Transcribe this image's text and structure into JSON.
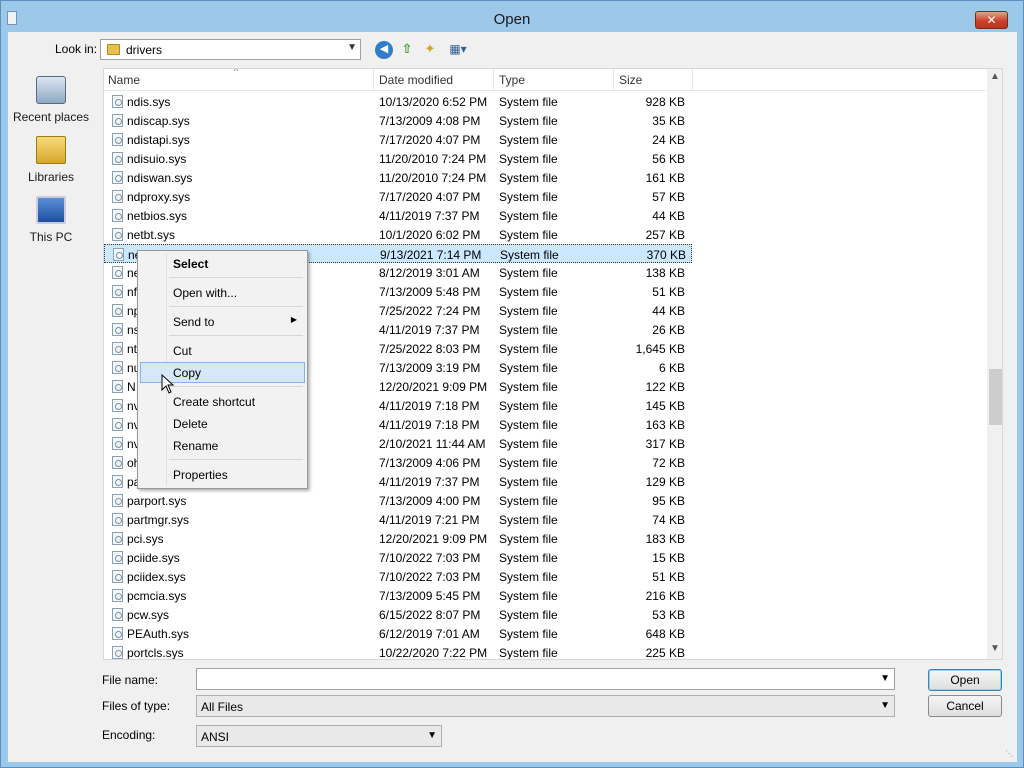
{
  "window": {
    "title": "Open",
    "close_label": "✕"
  },
  "toolbar": {
    "lookin_label": "Look in:",
    "lookin_value": "drivers",
    "back_icon": "back-icon",
    "up_icon": "up-folder-icon",
    "new_folder_icon": "new-folder-icon",
    "view_icon": "view-menu-icon"
  },
  "places": [
    {
      "label": "Recent places",
      "icon": "recent-places-icon"
    },
    {
      "label": "Libraries",
      "icon": "libraries-icon"
    },
    {
      "label": "This PC",
      "icon": "this-pc-icon"
    }
  ],
  "columns": {
    "name": "Name",
    "date": "Date modified",
    "type": "Type",
    "size": "Size"
  },
  "files": [
    {
      "name": "ndis.sys",
      "date": "10/13/2020 6:52 PM",
      "type": "System file",
      "size": "928 KB"
    },
    {
      "name": "ndiscap.sys",
      "date": "7/13/2009 4:08 PM",
      "type": "System file",
      "size": "35 KB"
    },
    {
      "name": "ndistapi.sys",
      "date": "7/17/2020 4:07 PM",
      "type": "System file",
      "size": "24 KB"
    },
    {
      "name": "ndisuio.sys",
      "date": "11/20/2010 7:24 PM",
      "type": "System file",
      "size": "56 KB"
    },
    {
      "name": "ndiswan.sys",
      "date": "11/20/2010 7:24 PM",
      "type": "System file",
      "size": "161 KB"
    },
    {
      "name": "ndproxy.sys",
      "date": "7/17/2020 4:07 PM",
      "type": "System file",
      "size": "57 KB"
    },
    {
      "name": "netbios.sys",
      "date": "4/11/2019 7:37 PM",
      "type": "System file",
      "size": "44 KB"
    },
    {
      "name": "netbt.sys",
      "date": "10/1/2020 6:02 PM",
      "type": "System file",
      "size": "257 KB"
    },
    {
      "name": "ne",
      "date": "9/13/2021 7:14 PM",
      "type": "System file",
      "size": "370 KB"
    },
    {
      "name": "ne",
      "date": "8/12/2019 3:01 AM",
      "type": "System file",
      "size": "138 KB"
    },
    {
      "name": "nf",
      "date": "7/13/2009 5:48 PM",
      "type": "System file",
      "size": "51 KB"
    },
    {
      "name": "np",
      "date": "7/25/2022 7:24 PM",
      "type": "System file",
      "size": "44 KB"
    },
    {
      "name": "ns",
      "date": "4/11/2019 7:37 PM",
      "type": "System file",
      "size": "26 KB"
    },
    {
      "name": "nt",
      "date": "7/25/2022 8:03 PM",
      "type": "System file",
      "size": "1,645 KB"
    },
    {
      "name": "nu",
      "date": "7/13/2009 3:19 PM",
      "type": "System file",
      "size": "6 KB"
    },
    {
      "name": "N",
      "date": "12/20/2021 9:09 PM",
      "type": "System file",
      "size": "122 KB"
    },
    {
      "name": "nv",
      "date": "4/11/2019 7:18 PM",
      "type": "System file",
      "size": "145 KB"
    },
    {
      "name": "nv",
      "date": "4/11/2019 7:18 PM",
      "type": "System file",
      "size": "163 KB"
    },
    {
      "name": "nv",
      "date": "2/10/2021 11:44 AM",
      "type": "System file",
      "size": "317 KB"
    },
    {
      "name": "oh",
      "date": "7/13/2009 4:06 PM",
      "type": "System file",
      "size": "72 KB"
    },
    {
      "name": "pa",
      "date": "4/11/2019 7:37 PM",
      "type": "System file",
      "size": "129 KB"
    },
    {
      "name": "parport.sys",
      "date": "7/13/2009 4:00 PM",
      "type": "System file",
      "size": "95 KB"
    },
    {
      "name": "partmgr.sys",
      "date": "4/11/2019 7:21 PM",
      "type": "System file",
      "size": "74 KB"
    },
    {
      "name": "pci.sys",
      "date": "12/20/2021 9:09 PM",
      "type": "System file",
      "size": "183 KB"
    },
    {
      "name": "pciide.sys",
      "date": "7/10/2022 7:03 PM",
      "type": "System file",
      "size": "15 KB"
    },
    {
      "name": "pciidex.sys",
      "date": "7/10/2022 7:03 PM",
      "type": "System file",
      "size": "51 KB"
    },
    {
      "name": "pcmcia.sys",
      "date": "7/13/2009 5:45 PM",
      "type": "System file",
      "size": "216 KB"
    },
    {
      "name": "pcw.sys",
      "date": "6/15/2022 8:07 PM",
      "type": "System file",
      "size": "53 KB"
    },
    {
      "name": "PEAuth.sys",
      "date": "6/12/2019 7:01 AM",
      "type": "System file",
      "size": "648 KB"
    },
    {
      "name": "portcls.sys",
      "date": "10/22/2020 7:22 PM",
      "type": "System file",
      "size": "225 KB"
    }
  ],
  "selected_index": 8,
  "context_menu": {
    "select": "Select",
    "open_with": "Open with...",
    "send_to": "Send to",
    "cut": "Cut",
    "copy": "Copy",
    "create_shortcut": "Create shortcut",
    "delete": "Delete",
    "rename": "Rename",
    "properties": "Properties"
  },
  "bottom": {
    "file_name_label": "File name:",
    "file_name_value": "",
    "files_of_type_label": "Files of type:",
    "files_of_type_value": "All Files",
    "encoding_label": "Encoding:",
    "encoding_value": "ANSI",
    "open_button": "Open",
    "cancel_button": "Cancel"
  }
}
